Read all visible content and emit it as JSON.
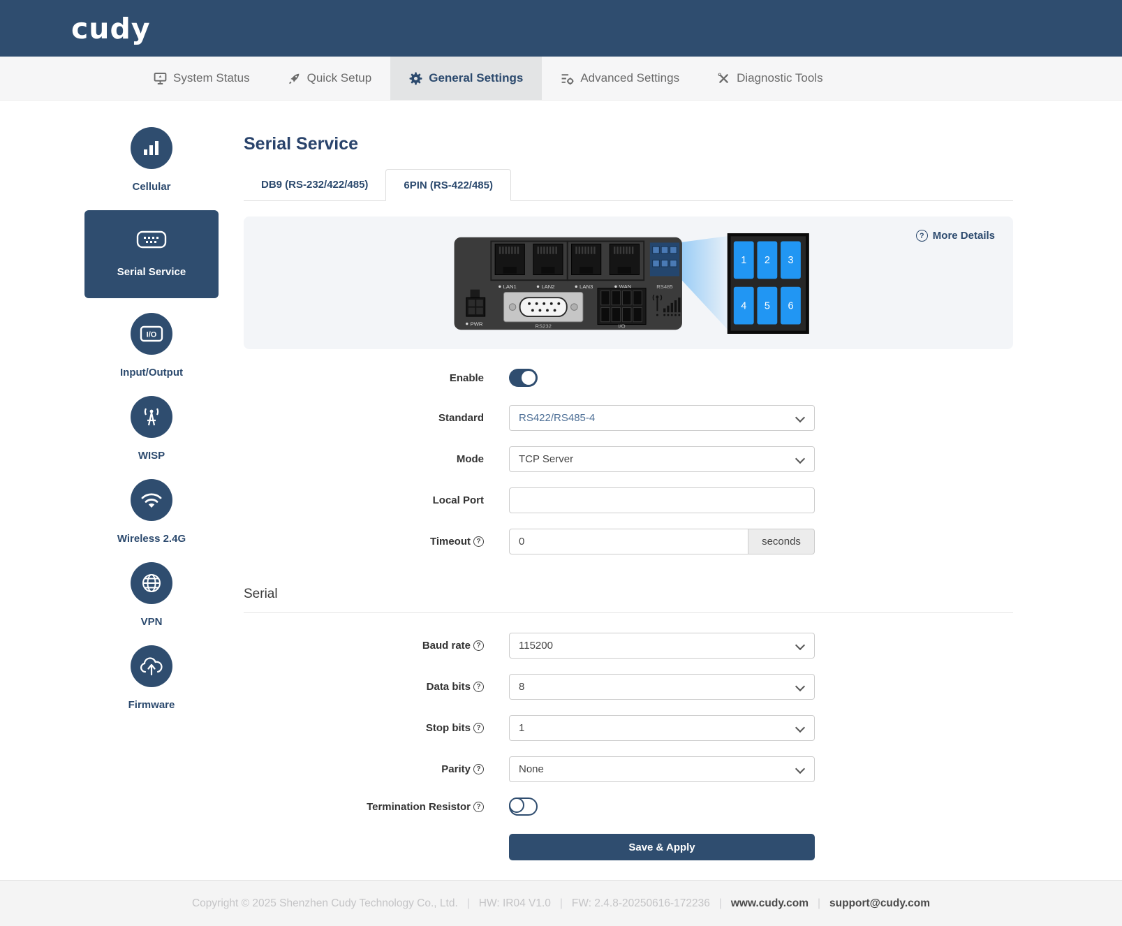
{
  "header": {
    "logo": "cudy"
  },
  "nav": {
    "items": [
      {
        "label": "System Status",
        "icon": "monitor-icon"
      },
      {
        "label": "Quick Setup",
        "icon": "rocket-icon"
      },
      {
        "label": "General Settings",
        "icon": "gear-icon",
        "active": true
      },
      {
        "label": "Advanced Settings",
        "icon": "sliders-icon"
      },
      {
        "label": "Diagnostic Tools",
        "icon": "tools-icon"
      }
    ]
  },
  "sidebar": {
    "items": [
      {
        "label": "Cellular",
        "icon": "signal-bars-icon"
      },
      {
        "label": "Serial Service",
        "icon": "serial-port-icon",
        "selected": true
      },
      {
        "label": "Input/Output",
        "icon": "io-icon"
      },
      {
        "label": "WISP",
        "icon": "antenna-icon"
      },
      {
        "label": "Wireless 2.4G",
        "icon": "wifi-icon"
      },
      {
        "label": "VPN",
        "icon": "globe-icon"
      },
      {
        "label": "Firmware",
        "icon": "cloud-upload-icon"
      }
    ]
  },
  "main": {
    "title": "Serial Service",
    "tabs": [
      {
        "label": "DB9 (RS-232/422/485)",
        "active": false
      },
      {
        "label": "6PIN (RS-422/485)",
        "active": true
      }
    ],
    "device": {
      "more_details": "More Details",
      "ports": {
        "lan1": "LAN1",
        "lan2": "LAN2",
        "lan3": "LAN3",
        "wan": "WAN",
        "rs485": "RS485",
        "pwr": "PWR",
        "rs232": "RS232",
        "io": "I/O"
      },
      "pins": [
        "1",
        "2",
        "3",
        "4",
        "5",
        "6"
      ]
    },
    "form": {
      "enable": {
        "label": "Enable",
        "value": true
      },
      "standard": {
        "label": "Standard",
        "value": "RS422/RS485-4"
      },
      "mode": {
        "label": "Mode",
        "value": "TCP Server"
      },
      "local_port": {
        "label": "Local Port",
        "value": ""
      },
      "timeout": {
        "label": "Timeout",
        "value": "0",
        "unit": "seconds"
      }
    },
    "serial": {
      "title": "Serial",
      "baud_rate": {
        "label": "Baud rate",
        "value": "115200"
      },
      "data_bits": {
        "label": "Data bits",
        "value": "8"
      },
      "stop_bits": {
        "label": "Stop bits",
        "value": "1"
      },
      "parity": {
        "label": "Parity",
        "value": "None"
      },
      "termination": {
        "label": "Termination Resistor",
        "value": false
      },
      "save_label": "Save & Apply"
    }
  },
  "footer": {
    "copyright": "Copyright © 2025 Shenzhen Cudy Technology Co., Ltd.",
    "hw": "HW: IR04 V1.0",
    "fw": "FW: 2.4.8-20250616-172236",
    "site": "www.cudy.com",
    "email": "support@cudy.com",
    "separator": "|"
  },
  "colors": {
    "navy": "#2f4d6f",
    "pin_blue": "#2196f3",
    "nav_active_bg": "#e3e4e5"
  }
}
